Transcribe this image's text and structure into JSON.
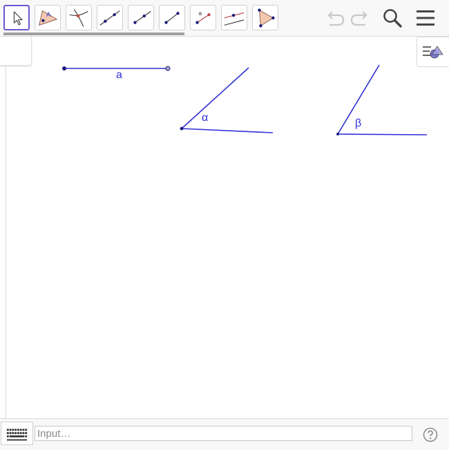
{
  "toolbar": {
    "tools": [
      {
        "name": "move-tool-button",
        "icon": "cursor-arrow-icon",
        "active": true
      },
      {
        "name": "polygon-tool-button",
        "icon": "polygon-point-a-icon",
        "active": false
      },
      {
        "name": "intersect-tool-button",
        "icon": "intersect-curves-icon",
        "active": false
      },
      {
        "name": "line-tool-button",
        "icon": "line-two-points-icon",
        "active": false
      },
      {
        "name": "ray-tool-button",
        "icon": "ray-icon",
        "active": false
      },
      {
        "name": "segment-tool-button",
        "icon": "segment-icon",
        "active": false
      },
      {
        "name": "segment-fixed-length-tool-button",
        "icon": "segment-length-a-icon",
        "active": false
      },
      {
        "name": "parallel-line-tool-button",
        "icon": "parallel-line-icon",
        "active": false
      },
      {
        "name": "polygon-triangle-tool-button",
        "icon": "triangle-icon",
        "active": false
      }
    ],
    "segment_length_glyph": "a",
    "polygon_glyph": "A",
    "undo_icon": "undo-icon",
    "redo_icon": "redo-icon",
    "search_icon": "search-icon",
    "menu_icon": "hamburger-menu-icon"
  },
  "canvas": {
    "labels": {
      "segment": "a",
      "angle_alpha": "α",
      "angle_beta": "β"
    },
    "object_color": "#2f2fd6"
  },
  "inputbar": {
    "placeholder": "Input…",
    "keyboard_icon": "keyboard-icon",
    "help_icon": "help-icon"
  },
  "colors": {
    "accent": "#6557d2",
    "object": "#2f2fd6",
    "point": "#1a1a7a"
  }
}
